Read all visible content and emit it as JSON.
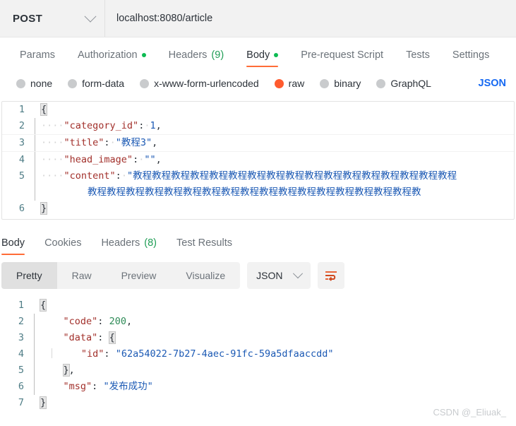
{
  "request_bar": {
    "method": "POST",
    "method_icon": "chevron-down-icon",
    "url": "localhost:8080/article"
  },
  "request_tabs": [
    {
      "label": "Params",
      "dot": false,
      "count": "",
      "active": false
    },
    {
      "label": "Authorization",
      "dot": true,
      "count": "",
      "active": false
    },
    {
      "label": "Headers",
      "dot": false,
      "count": "(9)",
      "active": false
    },
    {
      "label": "Body",
      "dot": true,
      "count": "",
      "active": true
    },
    {
      "label": "Pre-request Script",
      "dot": false,
      "count": "",
      "active": false
    },
    {
      "label": "Tests",
      "dot": false,
      "count": "",
      "active": false
    },
    {
      "label": "Settings",
      "dot": false,
      "count": "",
      "active": false
    }
  ],
  "body_types": {
    "options": [
      {
        "label": "none",
        "selected": false
      },
      {
        "label": "form-data",
        "selected": false
      },
      {
        "label": "x-www-form-urlencoded",
        "selected": false
      },
      {
        "label": "raw",
        "selected": true
      },
      {
        "label": "binary",
        "selected": false
      },
      {
        "label": "GraphQL",
        "selected": false
      }
    ],
    "format": "JSON"
  },
  "request_body": {
    "line_numbers": [
      "1",
      "2",
      "3",
      "4",
      "5",
      "6"
    ],
    "l1_brace": "{",
    "l2_key": "\"category_id\"",
    "l2_colon": ":",
    "l2_value": "1",
    "l2_comma": ",",
    "l3_key": "\"title\"",
    "l3_colon": ":",
    "l3_value": "\"教程3\"",
    "l3_comma": ",",
    "l4_key": "\"head_image\"",
    "l4_colon": ":",
    "l4_value": "\"\"",
    "l4_comma": ",",
    "l5_key": "\"content\"",
    "l5_colon": ":",
    "l5_value": "\"教程教程教程教程教程教程教程教程教程教程教程教程教程教程教程教程教程",
    "l5_wrap": "教程教程教程教程教程教程教程教程教程教程教程教程教程教程教程教程教程教",
    "l6_brace": "}",
    "indent_dots": "····"
  },
  "response_tabs": [
    {
      "label": "Body",
      "count": "",
      "active": true
    },
    {
      "label": "Cookies",
      "count": "",
      "active": false
    },
    {
      "label": "Headers",
      "count": "(8)",
      "active": false
    },
    {
      "label": "Test Results",
      "count": "",
      "active": false
    }
  ],
  "response_toolbar": {
    "views": [
      {
        "label": "Pretty",
        "active": true
      },
      {
        "label": "Raw",
        "active": false
      },
      {
        "label": "Preview",
        "active": false
      },
      {
        "label": "Visualize",
        "active": false
      }
    ],
    "format": "JSON",
    "format_icon": "chevron-down-icon",
    "wrap_button_icon": "word-wrap-icon"
  },
  "response_body": {
    "line_numbers": [
      "1",
      "2",
      "3",
      "4",
      "5",
      "6",
      "7"
    ],
    "l1_brace": "{",
    "l2_key": "\"code\"",
    "l2_colon": ":",
    "l2_value": "200",
    "l2_comma": ",",
    "l3_key": "\"data\"",
    "l3_colon": ":",
    "l3_brace": "{",
    "l4_key": "\"id\"",
    "l4_colon": ":",
    "l4_value": "\"62a54022-7b27-4aec-91fc-59a5dfaaccdd\"",
    "l5_brace": "}",
    "l5_comma": ",",
    "l6_key": "\"msg\"",
    "l6_colon": ":",
    "l6_value": "\"发布成功\"",
    "l7_brace": "}"
  },
  "watermark": "CSDN @_Eliuak_",
  "colors": {
    "accent_orange": "#ff6c37",
    "status_green": "#0cbb52",
    "link_blue": "#1669f2",
    "json_key": "#a2302b",
    "json_string": "#1b59b4",
    "json_number_green": "#2e8b57"
  }
}
